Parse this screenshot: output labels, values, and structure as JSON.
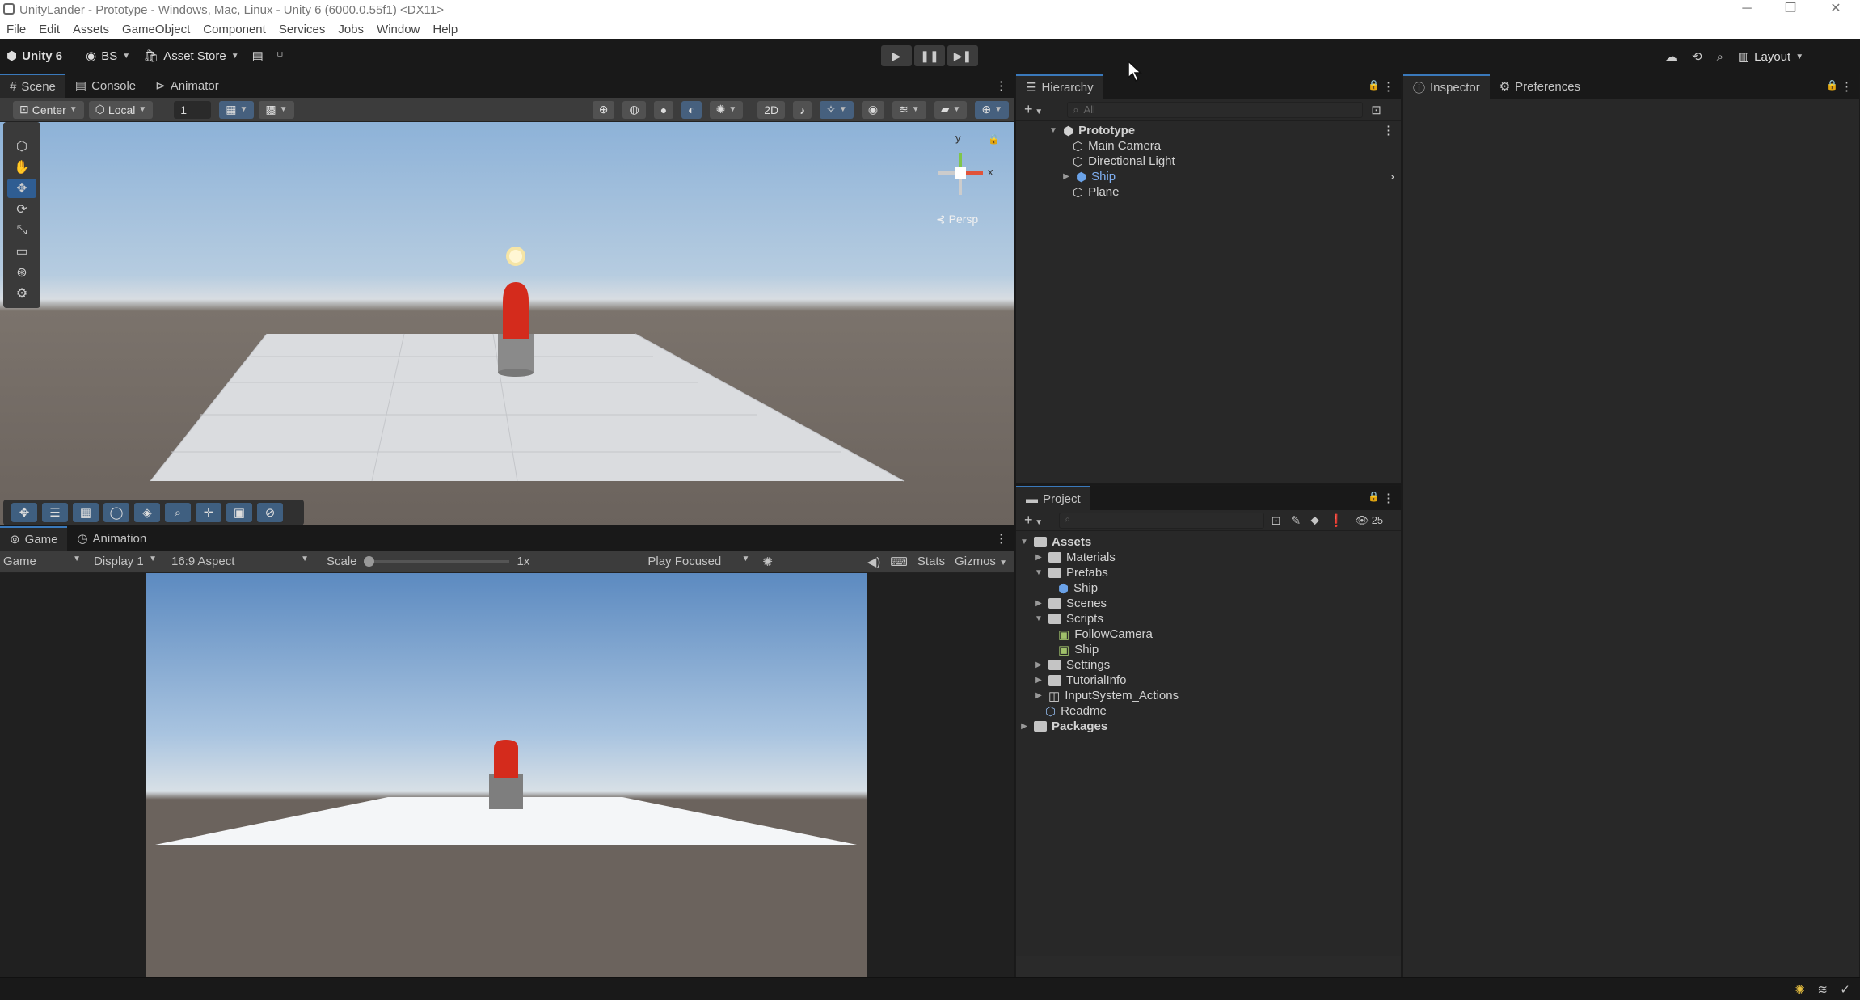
{
  "window": {
    "title": "UnityLander - Prototype - Windows, Mac, Linux - Unity 6 (6000.0.55f1) <DX11>"
  },
  "menu": [
    "File",
    "Edit",
    "Assets",
    "GameObject",
    "Component",
    "Services",
    "Jobs",
    "Window",
    "Help"
  ],
  "toolbar": {
    "unity_label": "Unity 6",
    "account": "BS",
    "asset_store": "Asset Store",
    "layout": "Layout"
  },
  "scene_panel": {
    "tabs": [
      "Scene",
      "Console",
      "Animator"
    ],
    "pivot": "Center",
    "space": "Local",
    "snap_value": "1",
    "persp_label": "Persp",
    "gizmo_axes": {
      "x": "x",
      "y": "y"
    }
  },
  "game_panel": {
    "tabs": [
      "Game",
      "Animation"
    ],
    "mode": "Game",
    "display": "Display 1",
    "aspect": "16:9 Aspect",
    "scale_label": "Scale",
    "scale_value": "1x",
    "play_mode": "Play Focused",
    "stats": "Stats",
    "gizmos": "Gizmos"
  },
  "hierarchy": {
    "tab": "Hierarchy",
    "search_placeholder": "All",
    "scene": "Prototype",
    "items": [
      "Main Camera",
      "Directional Light",
      "Ship",
      "Plane"
    ]
  },
  "project": {
    "tab": "Project",
    "count": "25",
    "root": "Assets",
    "items": [
      "Materials",
      "Prefabs",
      "Ship",
      "Scenes",
      "Scripts",
      "FollowCamera",
      "Ship",
      "Settings",
      "TutorialInfo",
      "InputSystem_Actions",
      "Readme"
    ],
    "packages": "Packages"
  },
  "inspector": {
    "tabs": [
      "Inspector",
      "Preferences"
    ]
  }
}
